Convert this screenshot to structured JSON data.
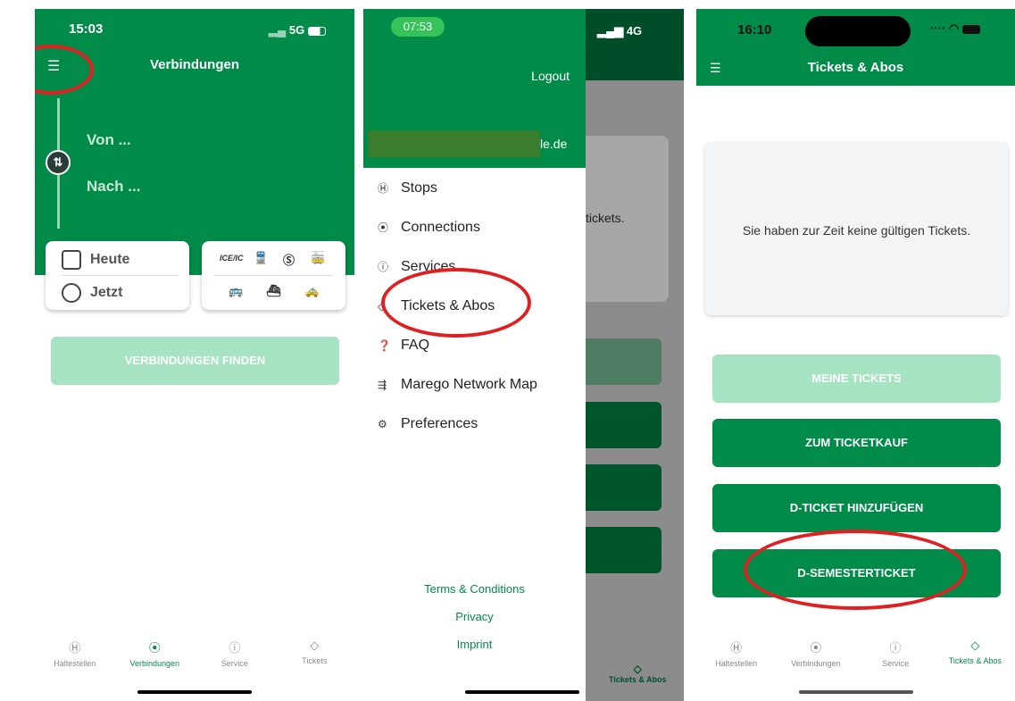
{
  "screen1": {
    "time": "15:03",
    "network": "5G",
    "title": "Verbindungen",
    "from_placeholder": "Von ...",
    "to_placeholder": "Nach ...",
    "date": "Heute",
    "time_select": "Jetzt",
    "modes": [
      "ICE/IC",
      "train",
      "S",
      "tram",
      "bus",
      "ferry",
      "taxi"
    ],
    "find_button": "VERBINDUNGEN FINDEN",
    "tabs": [
      "Haltestellen",
      "Verbindungen",
      "Service",
      "Tickets"
    ]
  },
  "screen2": {
    "time": "07:53",
    "network": "4G",
    "logout": "Logout",
    "email_suffix": "le.de",
    "menu_items": [
      "Stops",
      "Connections",
      "Services",
      "Tickets & Abos",
      "FAQ",
      "Marego Network Map",
      "Preferences"
    ],
    "footer_links": [
      "Terms & Conditions",
      "Privacy",
      "Imprint"
    ],
    "bg_text": "tickets.",
    "bg_tab": "Tickets & Abos"
  },
  "screen3": {
    "time": "16:10",
    "title": "Tickets & Abos",
    "empty_message": "Sie haben zur Zeit keine gültigen Tickets.",
    "buttons": [
      "MEINE TICKETS",
      "ZUM TICKETKAUF",
      "D-TICKET HINZUFÜGEN",
      "D-SEMESTERTICKET"
    ],
    "tabs": [
      "Haltestellen",
      "Verbindungen",
      "Service",
      "Tickets & Abos"
    ]
  },
  "colors": {
    "brand_green": "#008c48",
    "light_green": "#a6e3c3",
    "highlight_red": "#e02020"
  }
}
